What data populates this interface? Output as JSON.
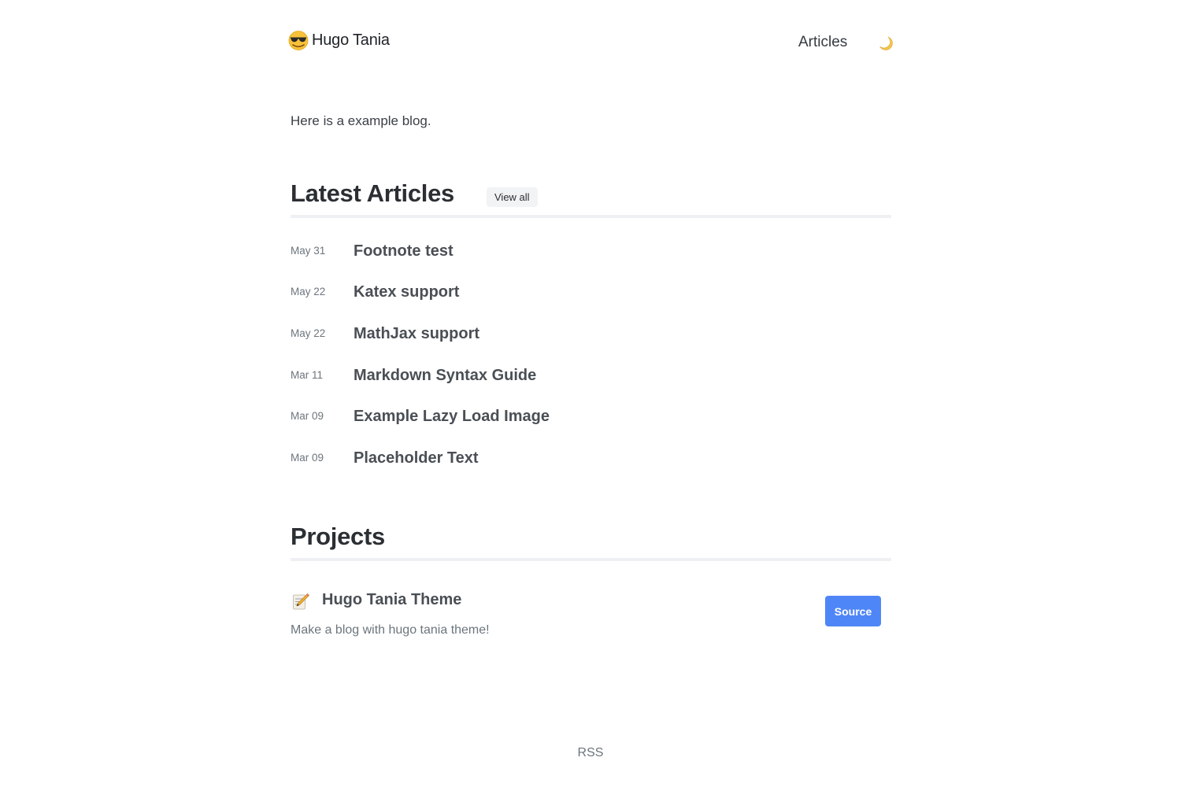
{
  "header": {
    "brand_name": "Hugo Tania",
    "brand_icon": "sunglasses-face-icon",
    "nav_articles": "Articles",
    "theme_icon": "moon-icon"
  },
  "intro": "Here is a example blog.",
  "latest": {
    "title": "Latest Articles",
    "view_all": "View all",
    "posts": [
      {
        "date": "May 31",
        "title": "Footnote test"
      },
      {
        "date": "May 22",
        "title": "Katex support"
      },
      {
        "date": "May 22",
        "title": "MathJax support"
      },
      {
        "date": "Mar 11",
        "title": "Markdown Syntax Guide"
      },
      {
        "date": "Mar 09",
        "title": "Example Lazy Load Image"
      },
      {
        "date": "Mar 09",
        "title": "Placeholder Text"
      }
    ]
  },
  "projects": {
    "title": "Projects",
    "items": [
      {
        "icon": "memo-icon",
        "name": "Hugo Tania Theme",
        "description": "Make a blog with hugo tania theme!",
        "button": "Source"
      }
    ]
  },
  "footer": {
    "rss": "RSS"
  },
  "colors": {
    "accent": "#4f86f7",
    "rule": "#eef0f4",
    "muted": "#6c757d"
  }
}
